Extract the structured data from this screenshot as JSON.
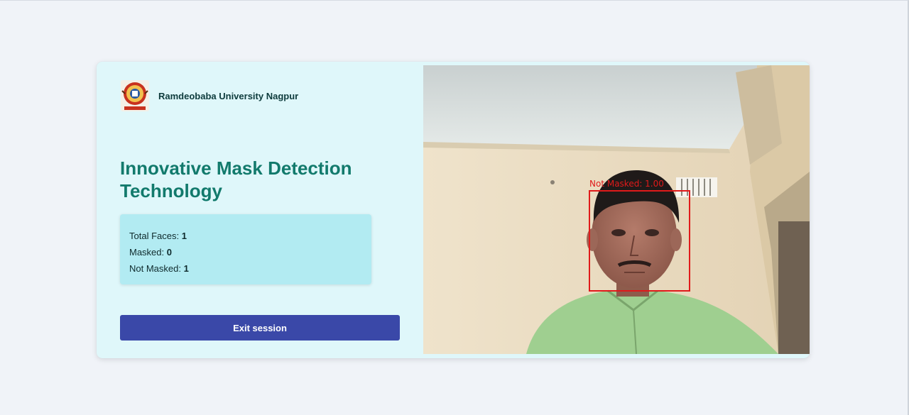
{
  "brand": {
    "name": "Ramdeobaba University Nagpur"
  },
  "headline": "Innovative Mask Detection Technology",
  "stats": {
    "total_faces_label": "Total Faces:",
    "total_faces_value": "1",
    "masked_label": "Masked:",
    "masked_value": "0",
    "not_masked_label": "Not Masked:",
    "not_masked_value": "1"
  },
  "actions": {
    "exit_label": "Exit session"
  },
  "camera": {
    "detection_label": "Not Masked: 1.00"
  },
  "colors": {
    "accent": "#127a6c",
    "button": "#3a48a8",
    "stats_bg": "#b2ebf2",
    "panel_bg": "#dff7fa",
    "detection": "#e01a1a"
  }
}
